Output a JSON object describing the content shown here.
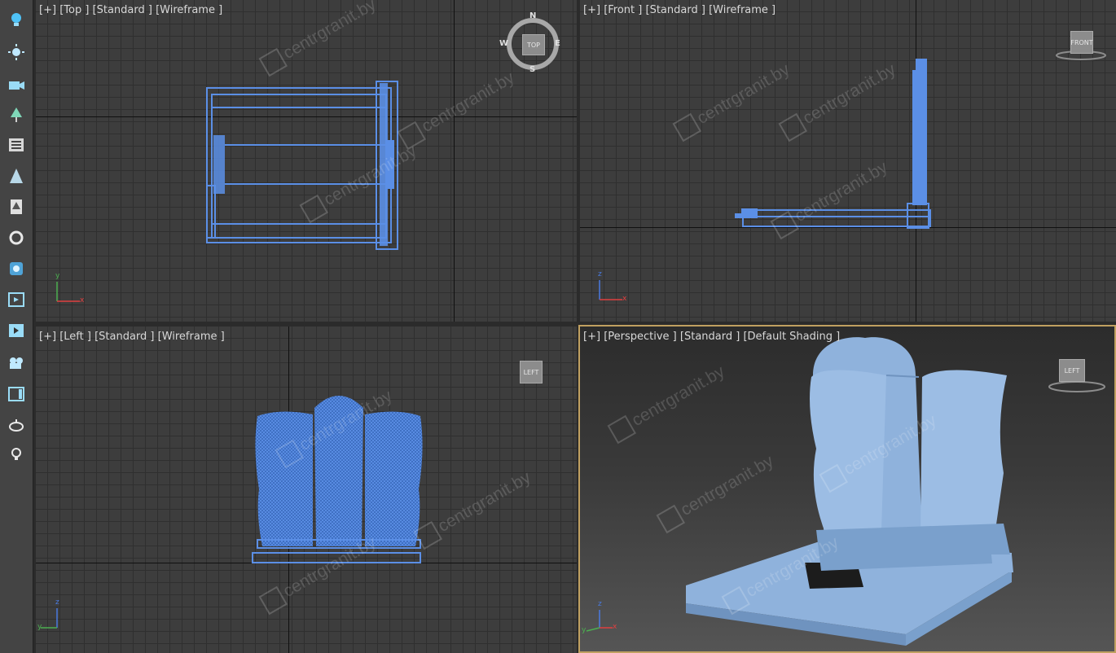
{
  "toolbar": {
    "tools": [
      {
        "icon": "lightbulb-icon"
      },
      {
        "icon": "sun-icon"
      },
      {
        "icon": "camera-icon"
      },
      {
        "icon": "tree-icon"
      },
      {
        "icon": "list-icon"
      },
      {
        "icon": "triangle-icon"
      },
      {
        "icon": "tree-alt-icon"
      },
      {
        "icon": "rotate-icon"
      },
      {
        "icon": "teapot-icon"
      },
      {
        "icon": "viewport-icon"
      },
      {
        "icon": "render-frame-icon"
      },
      {
        "icon": "camera-add-icon"
      },
      {
        "icon": "layout-icon"
      },
      {
        "icon": "pot-icon"
      },
      {
        "icon": "bulb-small-icon"
      }
    ]
  },
  "viewports": {
    "top": {
      "plus": "[+]",
      "view": "[Top ]",
      "preset": "[Standard ]",
      "shading": "[Wireframe ]",
      "compass": {
        "n": "N",
        "s": "S",
        "e": "E",
        "w": "W",
        "cube": "TOP"
      },
      "gizmo": {
        "x": "x",
        "y": "y"
      }
    },
    "front": {
      "plus": "[+]",
      "view": "[Front ]",
      "preset": "[Standard ]",
      "shading": "[Wireframe ]",
      "cube": "FRONT",
      "gizmo": {
        "x": "x",
        "z": "z"
      }
    },
    "left": {
      "plus": "[+]",
      "view": "[Left ]",
      "preset": "[Standard ]",
      "shading": "[Wireframe ]",
      "cube": "LEFT",
      "gizmo": {
        "y": "y",
        "z": "z"
      }
    },
    "perspective": {
      "plus": "[+]",
      "view": "[Perspective ]",
      "preset": "[Standard ]",
      "shading": "[Default Shading ]",
      "cube": "LEFT",
      "gizmo": {
        "x": "x",
        "y": "y",
        "z": "z"
      }
    }
  },
  "watermark": "centrgranit.by",
  "colors": {
    "model": "#5b8fe6",
    "model_shaded": "#8fb2dc",
    "active_border": "#c0a060"
  }
}
